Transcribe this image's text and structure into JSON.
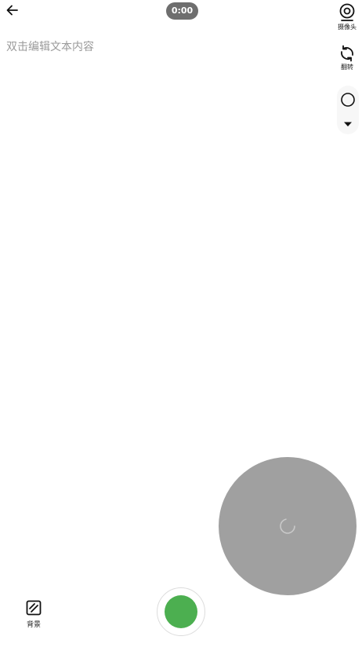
{
  "header": {
    "timer": "0:00"
  },
  "editor": {
    "placeholder": "双击编辑文本内容"
  },
  "side_tools": {
    "camera_label": "摄像头",
    "flip_label": "翻转"
  },
  "shape_selector": {
    "selected_shape": "circle"
  },
  "bottom_bar": {
    "background_label": "背景"
  },
  "colors": {
    "record_button": "#4caf50",
    "camera_preview": "#a0a0a0",
    "timer_badge": "#6e6e6e"
  },
  "icons": {
    "back": "arrow-left-icon",
    "camera": "webcam-icon",
    "flip": "rotate-icon",
    "shape": "circle-outline-icon",
    "dropdown": "caret-down-icon",
    "loading": "spinner-icon",
    "background": "hatched-square-icon"
  }
}
